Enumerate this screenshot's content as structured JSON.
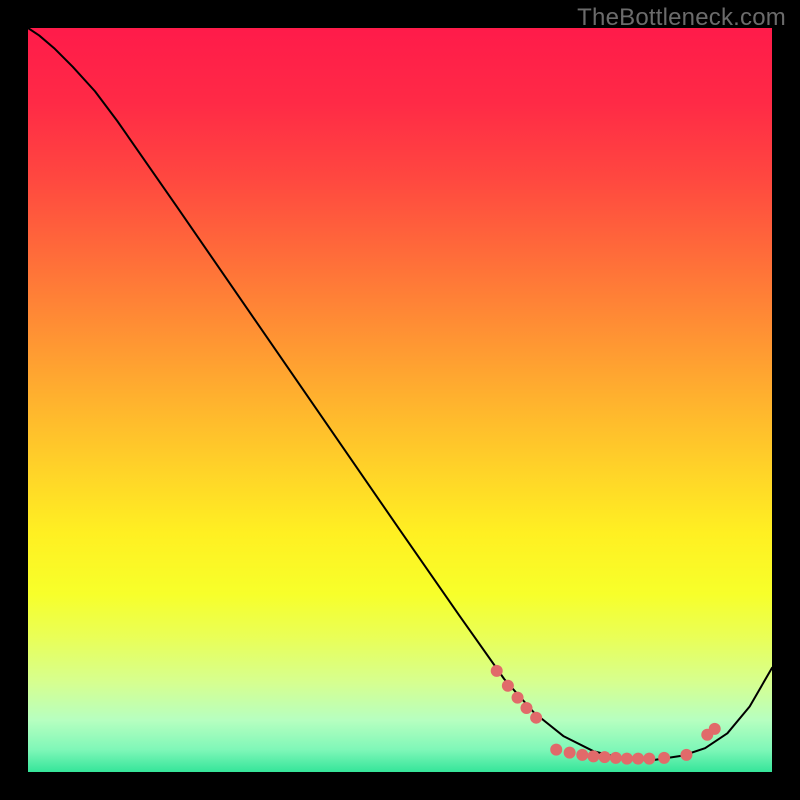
{
  "watermark": "TheBottleneck.com",
  "chart_data": {
    "type": "line",
    "title": "",
    "xlabel": "",
    "ylabel": "",
    "xlim": [
      0,
      100
    ],
    "ylim": [
      0,
      100
    ],
    "grid": false,
    "legend": false,
    "background_gradient": {
      "stops": [
        {
          "offset": 0.0,
          "color": "#ff1b4a"
        },
        {
          "offset": 0.1,
          "color": "#ff2a46"
        },
        {
          "offset": 0.2,
          "color": "#ff4740"
        },
        {
          "offset": 0.3,
          "color": "#ff6a3a"
        },
        {
          "offset": 0.4,
          "color": "#ff8e34"
        },
        {
          "offset": 0.5,
          "color": "#ffb22e"
        },
        {
          "offset": 0.6,
          "color": "#ffd528"
        },
        {
          "offset": 0.68,
          "color": "#fff022"
        },
        {
          "offset": 0.76,
          "color": "#f7ff2a"
        },
        {
          "offset": 0.82,
          "color": "#e9ff58"
        },
        {
          "offset": 0.88,
          "color": "#d6ff90"
        },
        {
          "offset": 0.93,
          "color": "#b7ffc0"
        },
        {
          "offset": 0.97,
          "color": "#7ff7b8"
        },
        {
          "offset": 1.0,
          "color": "#35e59a"
        }
      ]
    },
    "series": [
      {
        "name": "bottleneck-curve",
        "stroke": "#000000",
        "stroke_width": 2,
        "points": [
          {
            "x": 0.0,
            "y": 100.0
          },
          {
            "x": 1.5,
            "y": 99.0
          },
          {
            "x": 3.5,
            "y": 97.3
          },
          {
            "x": 6.0,
            "y": 94.8
          },
          {
            "x": 9.0,
            "y": 91.5
          },
          {
            "x": 12.0,
            "y": 87.5
          },
          {
            "x": 20.0,
            "y": 76.0
          },
          {
            "x": 30.0,
            "y": 61.5
          },
          {
            "x": 40.0,
            "y": 47.0
          },
          {
            "x": 50.0,
            "y": 32.5
          },
          {
            "x": 58.0,
            "y": 21.0
          },
          {
            "x": 64.0,
            "y": 12.5
          },
          {
            "x": 68.0,
            "y": 8.0
          },
          {
            "x": 72.0,
            "y": 4.8
          },
          {
            "x": 76.0,
            "y": 2.8
          },
          {
            "x": 80.0,
            "y": 1.8
          },
          {
            "x": 84.0,
            "y": 1.6
          },
          {
            "x": 88.0,
            "y": 2.2
          },
          {
            "x": 91.0,
            "y": 3.2
          },
          {
            "x": 94.0,
            "y": 5.2
          },
          {
            "x": 97.0,
            "y": 8.8
          },
          {
            "x": 100.0,
            "y": 14.0
          }
        ]
      },
      {
        "name": "marker-scatter",
        "marker_color": "#e16a6a",
        "marker_radius": 6,
        "points": [
          {
            "x": 63.0,
            "y": 13.6
          },
          {
            "x": 64.5,
            "y": 11.6
          },
          {
            "x": 65.8,
            "y": 10.0
          },
          {
            "x": 67.0,
            "y": 8.6
          },
          {
            "x": 68.3,
            "y": 7.3
          },
          {
            "x": 71.0,
            "y": 3.0
          },
          {
            "x": 72.8,
            "y": 2.6
          },
          {
            "x": 74.5,
            "y": 2.3
          },
          {
            "x": 76.0,
            "y": 2.1
          },
          {
            "x": 77.5,
            "y": 2.0
          },
          {
            "x": 79.0,
            "y": 1.9
          },
          {
            "x": 80.5,
            "y": 1.8
          },
          {
            "x": 82.0,
            "y": 1.8
          },
          {
            "x": 83.5,
            "y": 1.8
          },
          {
            "x": 85.5,
            "y": 1.9
          },
          {
            "x": 88.5,
            "y": 2.3
          },
          {
            "x": 91.3,
            "y": 5.0
          },
          {
            "x": 92.3,
            "y": 5.8
          }
        ]
      }
    ]
  }
}
